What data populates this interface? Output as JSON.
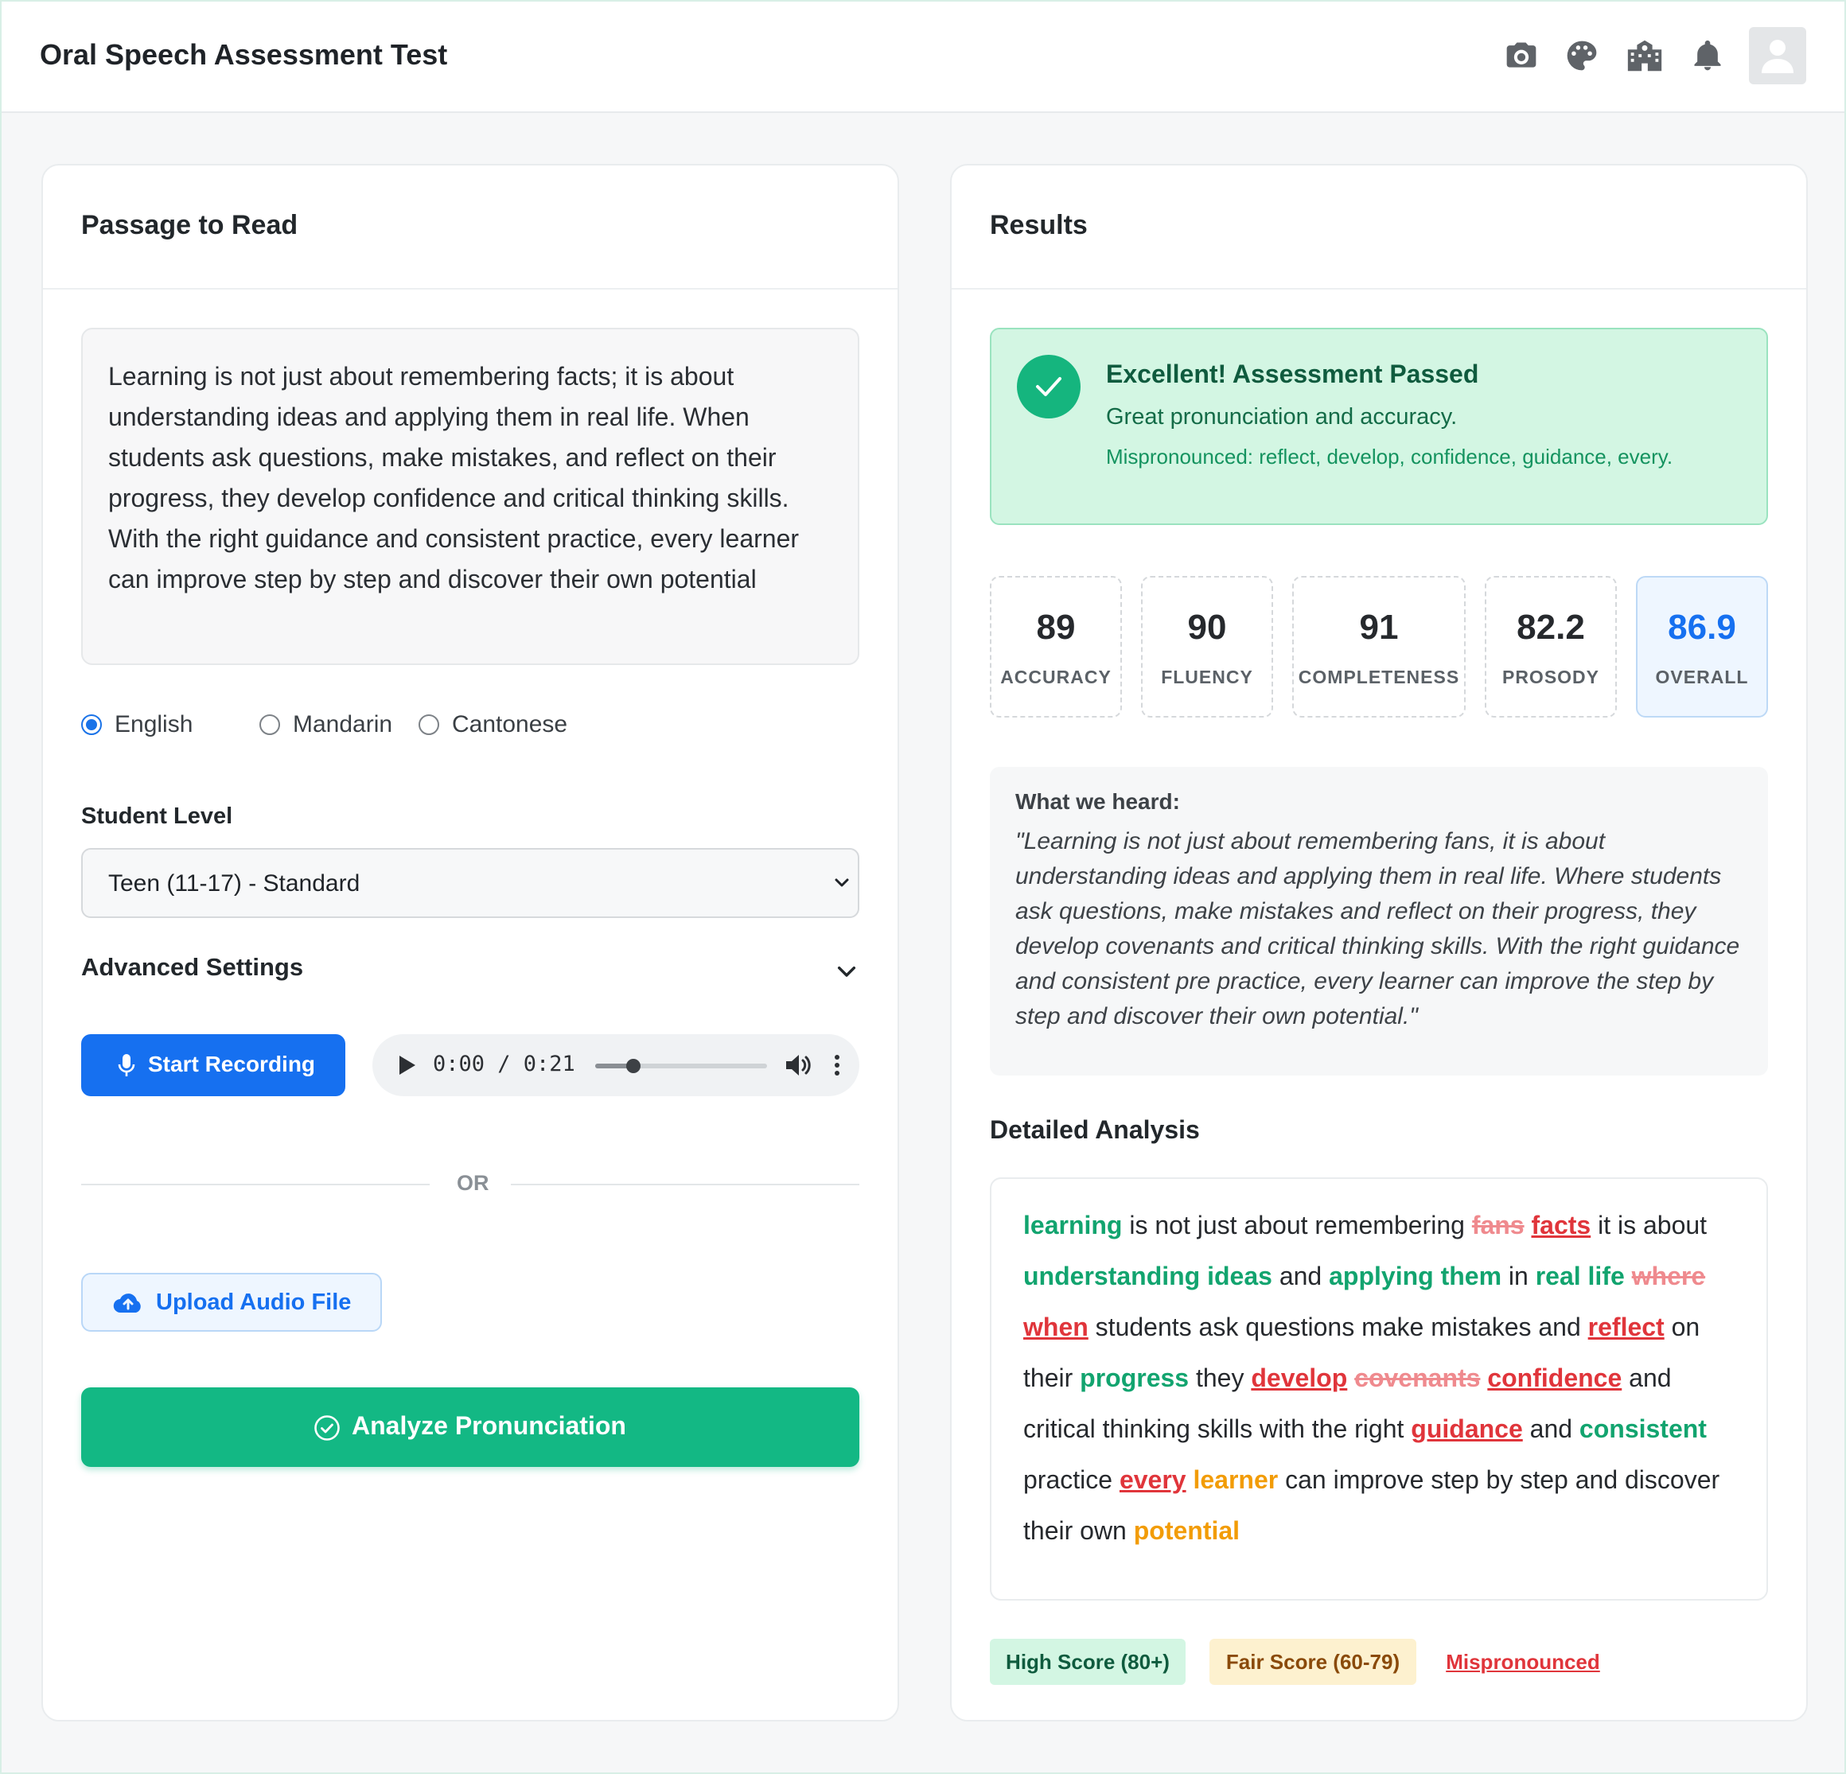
{
  "header": {
    "title": "Oral Speech Assessment Test",
    "icons": [
      "camera-icon",
      "palette-icon",
      "school-icon",
      "bell-icon",
      "user-avatar-icon"
    ]
  },
  "passage_card": {
    "title": "Passage to Read",
    "passage": "Learning is not just about remembering facts; it is about understanding ideas and applying them in real life. When students ask questions, make mistakes, and reflect on their progress, they develop confidence and critical thinking skills. With the right guidance and consistent practice, every learner can improve step by step and discover their own potential",
    "languages": [
      {
        "label": "English",
        "selected": true
      },
      {
        "label": "Mandarin",
        "selected": false
      },
      {
        "label": "Cantonese",
        "selected": false
      }
    ],
    "student_level_label": "Student Level",
    "student_level_value": "Teen (11-17) - Standard",
    "advanced_settings_label": "Advanced Settings",
    "record_button": "Start Recording",
    "player": {
      "time": "0:00 / 0:21",
      "progress": 0.22
    },
    "or_text": "OR",
    "upload_button": "Upload Audio File",
    "analyze_button": "Analyze Pronunciation"
  },
  "results_card": {
    "title": "Results",
    "banner": {
      "title": "Excellent! Assessment Passed",
      "subtitle": "Great pronunciation and accuracy.",
      "detail": "Mispronounced: reflect, develop, confidence, guidance, every."
    },
    "scores": [
      {
        "value": "89",
        "label": "ACCURACY"
      },
      {
        "value": "90",
        "label": "FLUENCY"
      },
      {
        "value": "91",
        "label": "COMPLETENESS"
      },
      {
        "value": "82.2",
        "label": "PROSODY"
      },
      {
        "value": "86.9",
        "label": "OVERALL"
      }
    ],
    "heard": {
      "label": "What we heard:",
      "text": "\"Learning is not just about remembering fans, it is about understanding ideas and applying them in real life. Where students ask questions, make mistakes and reflect on their progress, they develop covenants and critical thinking skills. With the right guidance and consistent pre practice, every learner can improve the step by step and discover their own potential.\""
    },
    "analysis_title": "Detailed Analysis",
    "analysis_words": [
      {
        "t": "learning",
        "s": "high"
      },
      {
        "t": "is not just about remembering",
        "s": "plain"
      },
      {
        "t": "fans",
        "s": "del"
      },
      {
        "t": "facts",
        "s": "mis"
      },
      {
        "t": "it is about",
        "s": "plain"
      },
      {
        "t": "understanding ideas",
        "s": "high"
      },
      {
        "t": "and",
        "s": "plain"
      },
      {
        "t": "applying them",
        "s": "high"
      },
      {
        "t": "in",
        "s": "plain"
      },
      {
        "t": "real life",
        "s": "high"
      },
      {
        "t": "where",
        "s": "del"
      },
      {
        "t": "when",
        "s": "mis"
      },
      {
        "t": "students ask questions make mistakes and",
        "s": "plain"
      },
      {
        "t": "reflect",
        "s": "mis"
      },
      {
        "t": "on their",
        "s": "plain"
      },
      {
        "t": "progress",
        "s": "high"
      },
      {
        "t": "they",
        "s": "plain"
      },
      {
        "t": "develop",
        "s": "mis"
      },
      {
        "t": "covenants",
        "s": "del"
      },
      {
        "t": "confidence",
        "s": "mis"
      },
      {
        "t": "and critical thinking skills with the right",
        "s": "plain"
      },
      {
        "t": "guidance",
        "s": "mis"
      },
      {
        "t": "and",
        "s": "plain"
      },
      {
        "t": "consistent",
        "s": "high"
      },
      {
        "t": "practice",
        "s": "plain"
      },
      {
        "t": "every",
        "s": "mis"
      },
      {
        "t": "learner",
        "s": "fair"
      },
      {
        "t": "can improve step by step and discover their own",
        "s": "plain"
      },
      {
        "t": "potential",
        "s": "fair"
      }
    ],
    "legend": {
      "high": "High Score (80+)",
      "fair": "Fair Score (60-79)",
      "mis": "Mispronounced"
    }
  }
}
